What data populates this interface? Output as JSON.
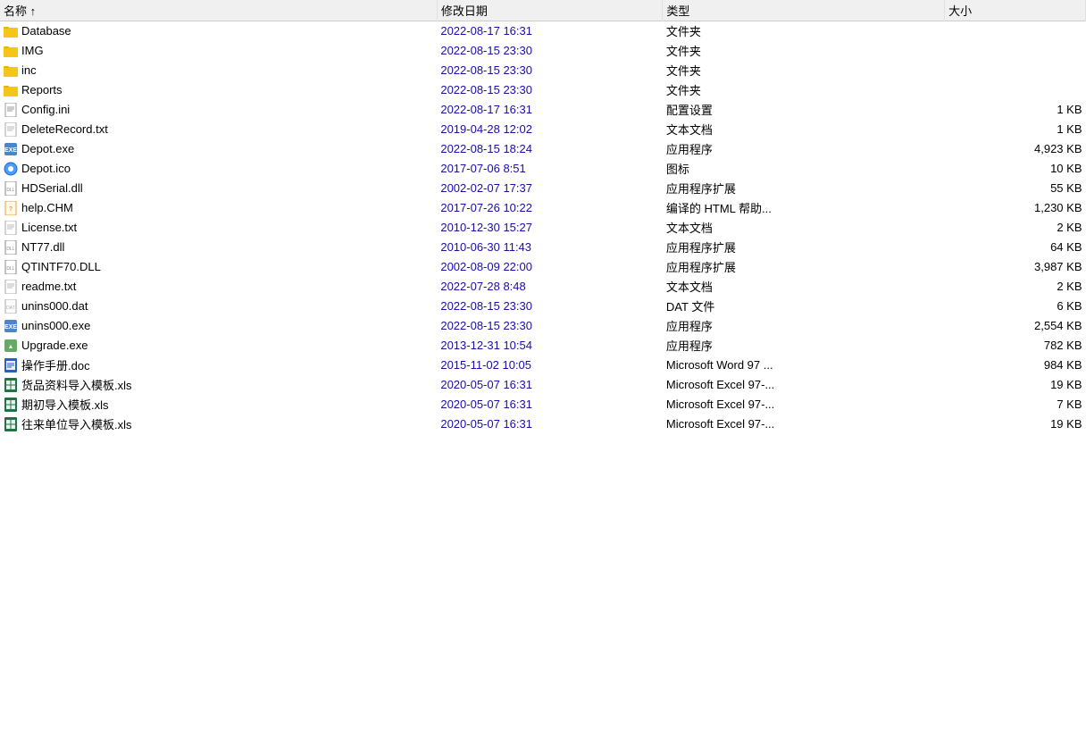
{
  "table": {
    "headers": [
      "名称 ↑",
      "修改日期",
      "类型",
      "大小"
    ],
    "rows": [
      {
        "id": "database",
        "name": "Database",
        "date": "2022-08-17 16:31",
        "type": "文件夹",
        "size": "",
        "icon": "folder"
      },
      {
        "id": "img",
        "name": "IMG",
        "date": "2022-08-15 23:30",
        "type": "文件夹",
        "size": "",
        "icon": "folder"
      },
      {
        "id": "inc",
        "name": "inc",
        "date": "2022-08-15 23:30",
        "type": "文件夹",
        "size": "",
        "icon": "folder"
      },
      {
        "id": "reports",
        "name": "Reports",
        "date": "2022-08-15 23:30",
        "type": "文件夹",
        "size": "",
        "icon": "folder"
      },
      {
        "id": "config-ini",
        "name": "Config.ini",
        "date": "2022-08-17 16:31",
        "type": "配置设置",
        "size": "1 KB",
        "icon": "config"
      },
      {
        "id": "deleterecord-txt",
        "name": "DeleteRecord.txt",
        "date": "2019-04-28 12:02",
        "type": "文本文档",
        "size": "1 KB",
        "icon": "txt"
      },
      {
        "id": "depot-exe",
        "name": "Depot.exe",
        "date": "2022-08-15 18:24",
        "type": "应用程序",
        "size": "4,923 KB",
        "icon": "exe"
      },
      {
        "id": "depot-ico",
        "name": "Depot.ico",
        "date": "2017-07-06 8:51",
        "type": "图标",
        "size": "10 KB",
        "icon": "ico"
      },
      {
        "id": "hdserial-dll",
        "name": "HDSerial.dll",
        "date": "2002-02-07 17:37",
        "type": "应用程序扩展",
        "size": "55 KB",
        "icon": "dll"
      },
      {
        "id": "help-chm",
        "name": "help.CHM",
        "date": "2017-07-26 10:22",
        "type": "编译的 HTML 帮助...",
        "size": "1,230 KB",
        "icon": "chm"
      },
      {
        "id": "license-txt",
        "name": "License.txt",
        "date": "2010-12-30 15:27",
        "type": "文本文档",
        "size": "2 KB",
        "icon": "txt"
      },
      {
        "id": "nt77-dll",
        "name": "NT77.dll",
        "date": "2010-06-30 11:43",
        "type": "应用程序扩展",
        "size": "64 KB",
        "icon": "dll"
      },
      {
        "id": "qtintf70-dll",
        "name": "QTINTF70.DLL",
        "date": "2002-08-09 22:00",
        "type": "应用程序扩展",
        "size": "3,987 KB",
        "icon": "dll"
      },
      {
        "id": "readme-txt",
        "name": "readme.txt",
        "date": "2022-07-28 8:48",
        "type": "文本文档",
        "size": "2 KB",
        "icon": "txt"
      },
      {
        "id": "unins000-dat",
        "name": "unins000.dat",
        "date": "2022-08-15 23:30",
        "type": "DAT 文件",
        "size": "6 KB",
        "icon": "dat"
      },
      {
        "id": "unins000-exe",
        "name": "unins000.exe",
        "date": "2022-08-15 23:30",
        "type": "应用程序",
        "size": "2,554 KB",
        "icon": "exe"
      },
      {
        "id": "upgrade-exe",
        "name": "Upgrade.exe",
        "date": "2013-12-31 10:54",
        "type": "应用程序",
        "size": "782 KB",
        "icon": "exe2"
      },
      {
        "id": "manual-doc",
        "name": "操作手册.doc",
        "date": "2015-11-02 10:05",
        "type": "Microsoft Word 97 ...",
        "size": "984 KB",
        "icon": "doc"
      },
      {
        "id": "goods-xls",
        "name": "货品资料导入模板.xls",
        "date": "2020-05-07 16:31",
        "type": "Microsoft Excel 97-...",
        "size": "19 KB",
        "icon": "xls"
      },
      {
        "id": "period-xls",
        "name": "期初导入模板.xls",
        "date": "2020-05-07 16:31",
        "type": "Microsoft Excel 97-...",
        "size": "7 KB",
        "icon": "xls"
      },
      {
        "id": "client-xls",
        "name": "往来单位导入模板.xls",
        "date": "2020-05-07 16:31",
        "type": "Microsoft Excel 97-...",
        "size": "19 KB",
        "icon": "xls"
      }
    ]
  }
}
